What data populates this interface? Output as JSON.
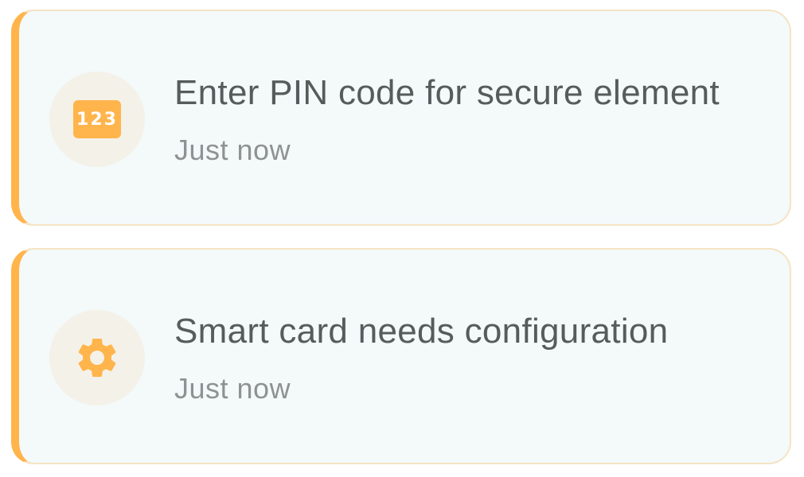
{
  "notifications": [
    {
      "icon": "pin-keypad-icon",
      "icon_text": "123",
      "title": "Enter PIN code for secure element",
      "time": "Just now"
    },
    {
      "icon": "gear-icon",
      "title": "Smart card needs configuration",
      "time": "Just now"
    }
  ],
  "colors": {
    "accent": "#ffb54c",
    "card_bg": "#f4f9fa",
    "card_border": "#f5e3c4",
    "icon_bg": "#f4f1e8",
    "title_text": "#565b5c",
    "time_text": "#8e9293"
  }
}
